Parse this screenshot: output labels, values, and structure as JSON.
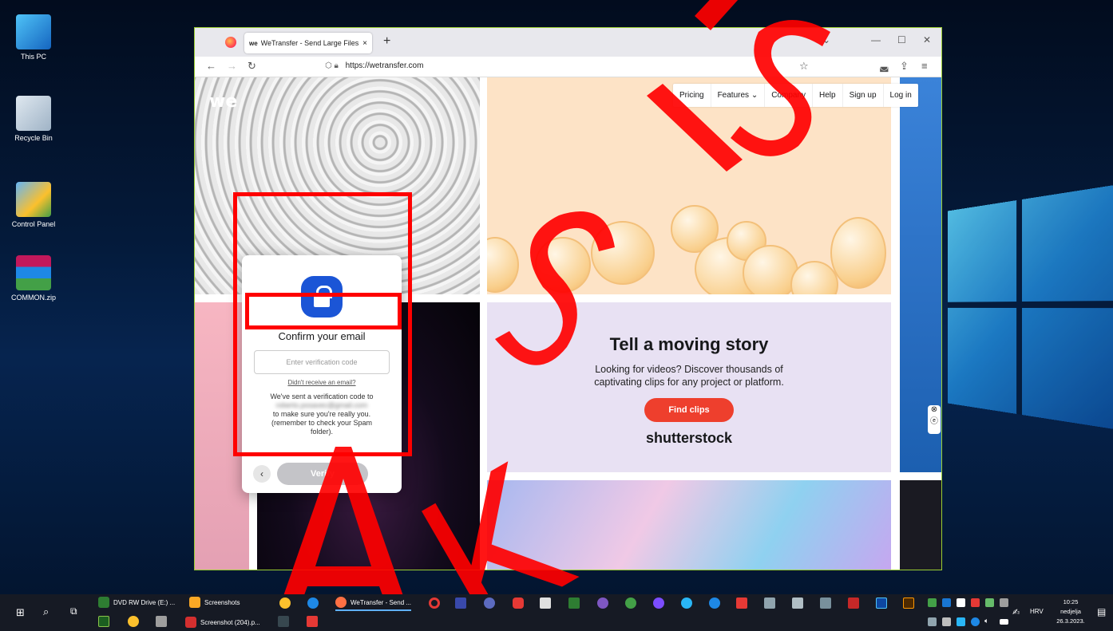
{
  "desktop": {
    "icons": [
      {
        "label": "This PC"
      },
      {
        "label": "Recycle Bin"
      },
      {
        "label": "Control Panel"
      },
      {
        "label": "COMMON.zip"
      }
    ]
  },
  "browser": {
    "tab_title": "WeTransfer - Send Large Files &",
    "tab_favicon": "we",
    "url": "https://wetransfer.com",
    "new_tab": "+",
    "close_tab": "×"
  },
  "site": {
    "logo": "we",
    "nav": [
      "Pricing",
      "Features ⌄",
      "Company",
      "Help",
      "Sign up",
      "Log in"
    ],
    "story": {
      "title": "Tell a moving story",
      "text_line1": "Looking for videos? Discover thousands of",
      "text_line2": "captivating clips for any project or platform.",
      "button": "Find clips",
      "brand": "shutterstock"
    },
    "modal": {
      "title": "Confirm your email",
      "input_placeholder": "Enter verification code",
      "didnt_receive": "Didn't receive an email?",
      "sent_line1": "We've sent a verification code to",
      "email_blurred": "roberto.posavec@gmail.com",
      "sent_line2": "to make sure you're really you.",
      "sent_line3": "(remember to check your Spam",
      "sent_line4": "folder).",
      "back": "‹",
      "verify": "Verify"
    }
  },
  "taskbar": {
    "row1": [
      "DVD RW Drive (E:) ...",
      "Screenshots",
      "WeTransfer - Send ..."
    ],
    "row2": [
      "Screenshot (204).p..."
    ],
    "lang": "HRV",
    "time": "10:25",
    "day": "nedjelja",
    "date": "26.3.2023."
  },
  "colors": {
    "accent_red": "#ee3f2d",
    "lock_blue": "#1b55d6",
    "annotation_red": "#ff0000"
  }
}
